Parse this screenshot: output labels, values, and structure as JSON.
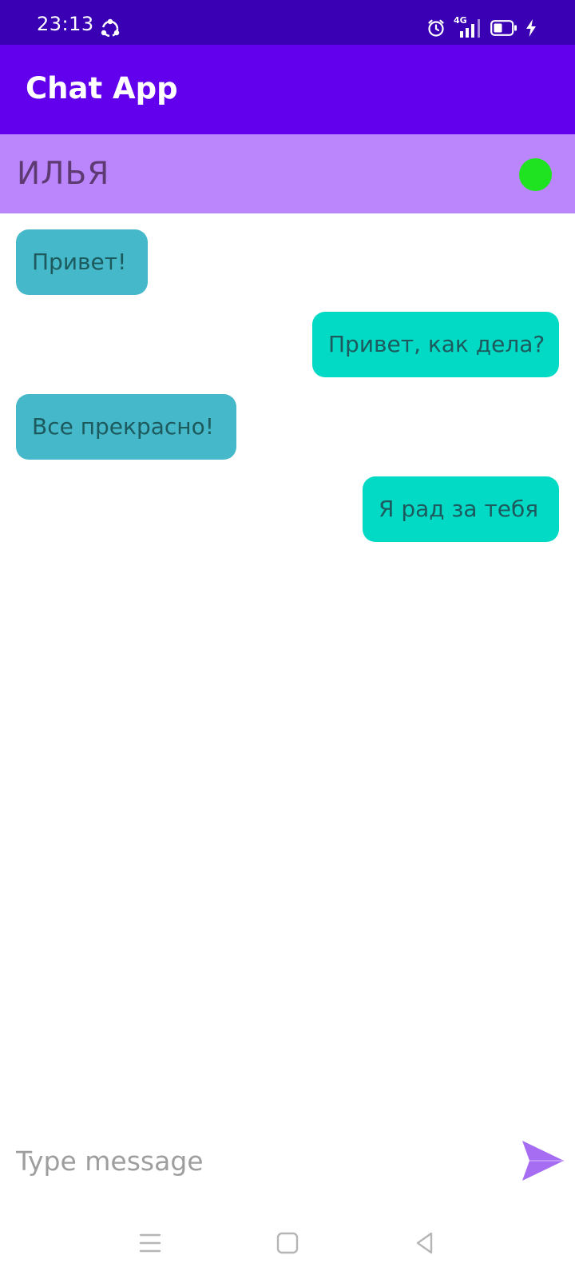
{
  "status_bar": {
    "time": "23:13",
    "network_label": "4G",
    "icons": [
      "sync-icon",
      "alarm-icon",
      "signal-icon",
      "battery-icon",
      "charging-icon"
    ]
  },
  "app_bar": {
    "title": "Chat App"
  },
  "contact": {
    "name": "ИЛЬЯ",
    "status_color": "#1fe320"
  },
  "messages": [
    {
      "text": "Привет!",
      "direction": "incoming"
    },
    {
      "text": "Привет, как дела?",
      "direction": "outgoing"
    },
    {
      "text": "Все прекрасно!",
      "direction": "incoming"
    },
    {
      "text": "Я рад за тебя",
      "direction": "outgoing"
    }
  ],
  "composer": {
    "value": "",
    "placeholder": "Type message",
    "send_icon": "send-icon"
  },
  "nav_bar": {
    "icons": [
      "menu-icon",
      "home-icon",
      "back-icon"
    ]
  },
  "colors": {
    "status_bar": "#3a00b4",
    "app_bar": "#6200ee",
    "contact_bar": "#bb86fc",
    "incoming_bubble": "#45b8c9",
    "outgoing_bubble": "#03dac5",
    "send_icon": "#a66cf2"
  }
}
